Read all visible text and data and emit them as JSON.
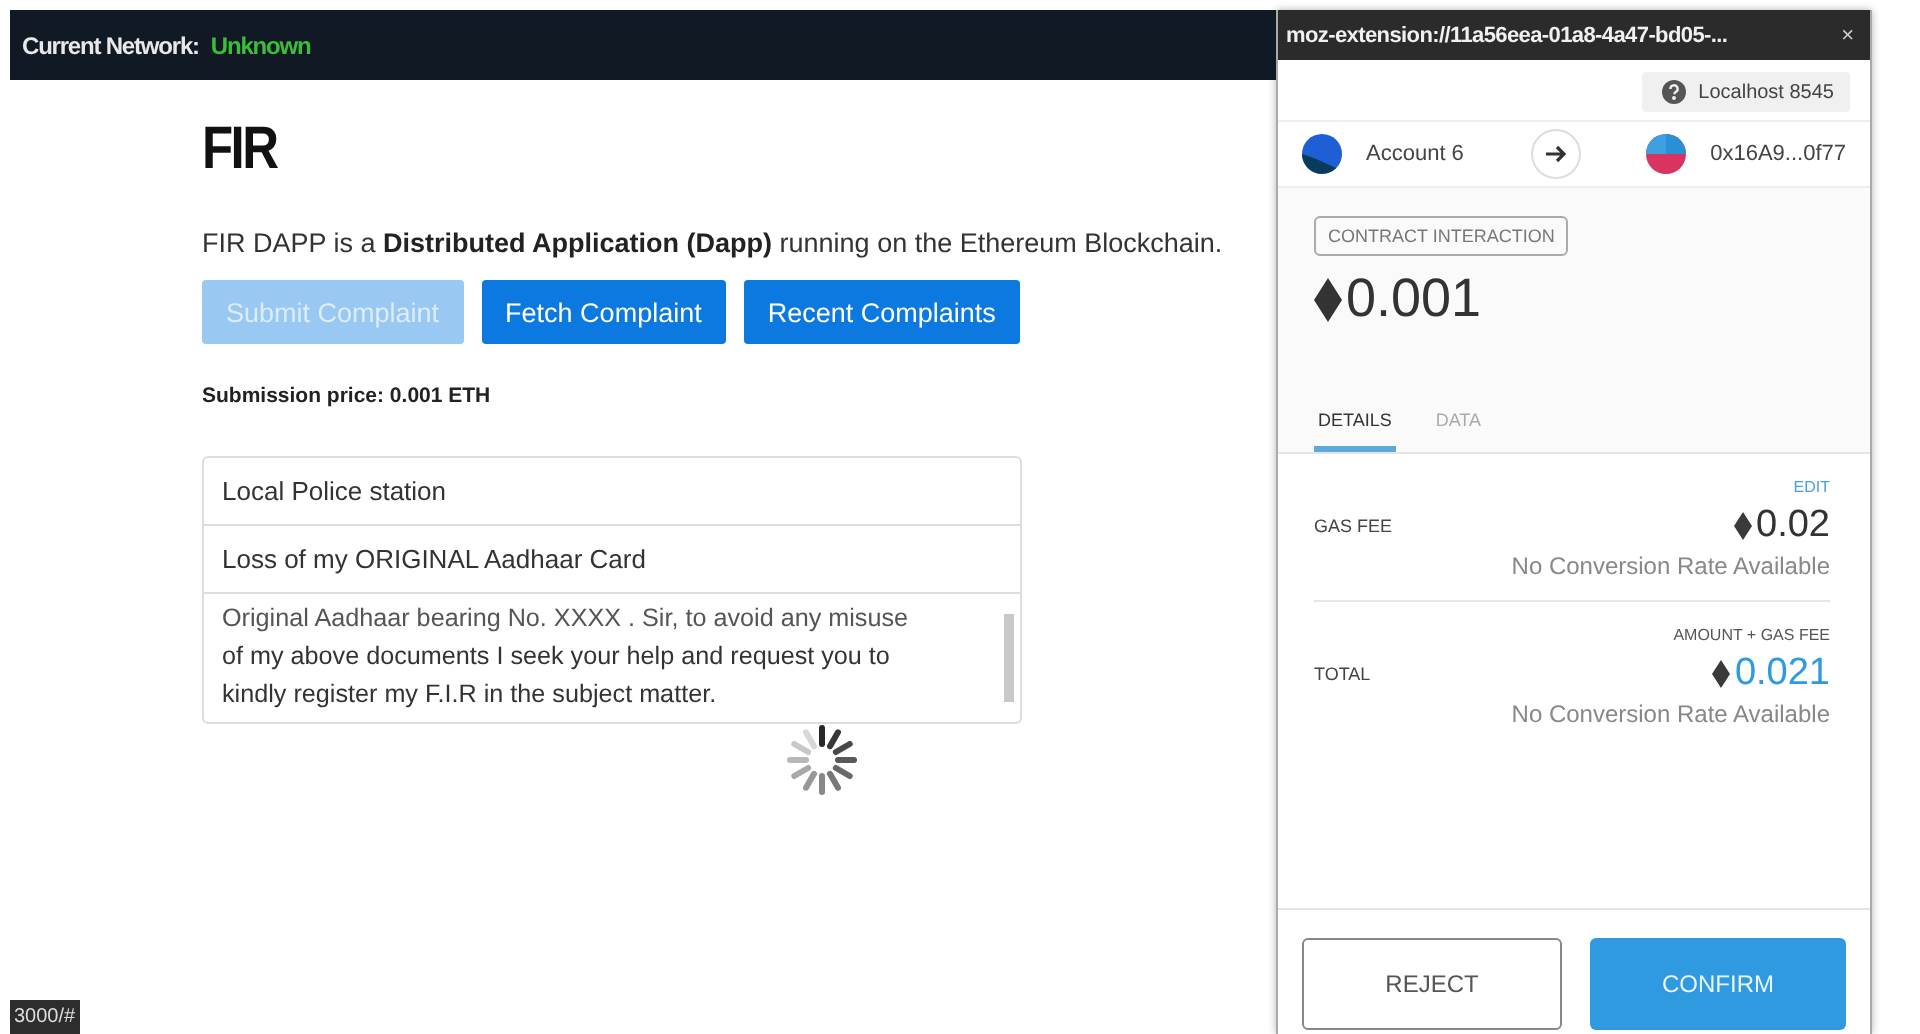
{
  "top_bar": {
    "label": "Current Network:",
    "network": "Unknown"
  },
  "page": {
    "title": "FIR",
    "description": "FIR DAPP is a **Distributed Application (Dapp)** running on the Ethereum Blockchain.",
    "buttons": [
      {
        "label": "Submit Complaint",
        "disabled": true
      },
      {
        "label": "Fetch Complaint",
        "disabled": false
      },
      {
        "label": "Recent Complaints",
        "disabled": false
      }
    ],
    "price": "Submission price: 0.001 ETH",
    "fields": [
      {
        "value": "Local Police station"
      },
      {
        "value": "Loss of my ORIGINAL Aadhaar Card"
      }
    ],
    "message": {
      "lines": [
        "Original Aadhaar bearing No. XXXX . Sir, to avoid any misuse",
        "of my above documents I seek your help and request you to",
        "kindly register my F.I.R in the subject matter."
      ]
    }
  },
  "status_bar": {
    "url": "3000/#"
  },
  "popup": {
    "title": "moz-extension://11a56eea-01a8-4a47-bd05-...",
    "close": "×",
    "network": "Localhost 8545",
    "from_account": "Account 6",
    "to_account": "0x16A9...0f77",
    "tag": "CONTRACT INTERACTION",
    "amount": "0.001",
    "tabs": [
      {
        "label": "DETAILS",
        "selected": true
      },
      {
        "label": "DATA",
        "selected": false
      }
    ],
    "rows": [
      {
        "kind": "fee",
        "top": "EDIT",
        "label": "GAS FEE",
        "amount": "0.02",
        "conversion": "No Conversion Rate Available"
      },
      {
        "kind": "total",
        "top": "AMOUNT + GAS FEE",
        "label": "TOTAL",
        "amount": "0.021",
        "conversion": "No Conversion Rate Available"
      }
    ],
    "buttons": [
      {
        "label": "REJECT",
        "kind": "secondary"
      },
      {
        "label": "CONFIRM",
        "kind": "primary"
      }
    ]
  }
}
